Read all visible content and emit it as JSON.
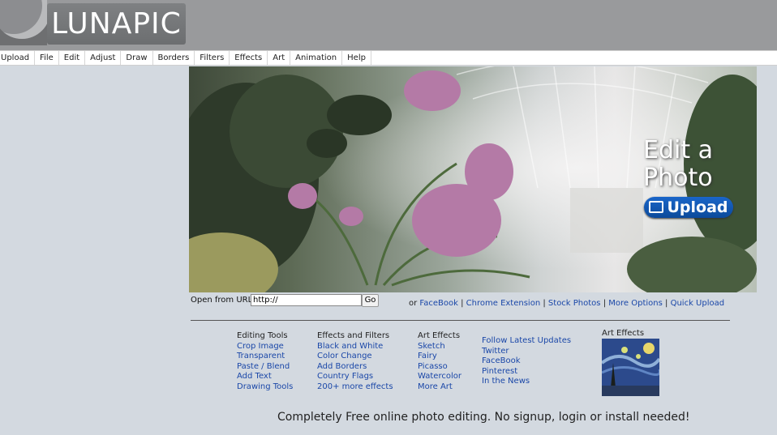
{
  "logo": {
    "text": "LUNAPIC"
  },
  "menu": [
    "Upload",
    "File",
    "Edit",
    "Adjust",
    "Draw",
    "Borders",
    "Filters",
    "Effects",
    "Art",
    "Animation",
    "Help"
  ],
  "hero": {
    "title_line1": "Edit a",
    "title_line2": "Photo",
    "upload_label": "Upload"
  },
  "url_row": {
    "label": "Open from URL:",
    "input_value": "http://",
    "go_label": "Go"
  },
  "options": {
    "prefix": "or",
    "links": [
      "FaceBook",
      "Chrome Extension",
      "Stock Photos",
      "More Options",
      "Quick Upload"
    ],
    "separator": "|"
  },
  "columns": [
    {
      "heading": "Editing Tools",
      "links": [
        "Crop Image",
        "Transparent",
        "Paste / Blend",
        "Add Text",
        "Drawing Tools"
      ]
    },
    {
      "heading": "Effects and Filters",
      "links": [
        "Black and White",
        "Color Change",
        "Add Borders",
        "Country Flags",
        "200+ more effects"
      ]
    },
    {
      "heading": "Art Effects",
      "links": [
        "Sketch",
        "Fairy",
        "Picasso",
        "Watercolor",
        "More Art"
      ]
    },
    {
      "heading": "",
      "links": [
        "Follow Latest Updates",
        "Twitter",
        "FaceBook",
        "Pinterest",
        "In the News"
      ]
    }
  ],
  "art_panel": {
    "title": "Art Effects"
  },
  "tagline": "Completely Free online photo editing. No signup, login or install needed!",
  "colors": {
    "link": "#1a47a8",
    "upload_button": "#1a66c9",
    "header": "#999a9c",
    "page_bg": "#d3d9e0"
  }
}
